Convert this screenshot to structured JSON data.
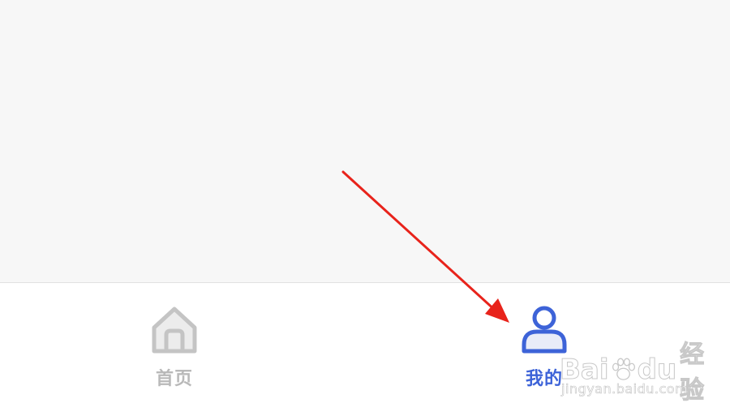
{
  "tab_bar": {
    "tabs": [
      {
        "label": "首页",
        "icon": "home-icon",
        "active": false,
        "color": "#b9b9b9"
      },
      {
        "label": "我的",
        "icon": "user-icon",
        "active": true,
        "color": "#3d63d8"
      }
    ]
  },
  "annotation": {
    "arrow_color": "#e8231b"
  },
  "watermark": {
    "brand_left": "Bai",
    "brand_right": "du",
    "suffix": "经验",
    "url": "jingyan.baidu.com"
  }
}
